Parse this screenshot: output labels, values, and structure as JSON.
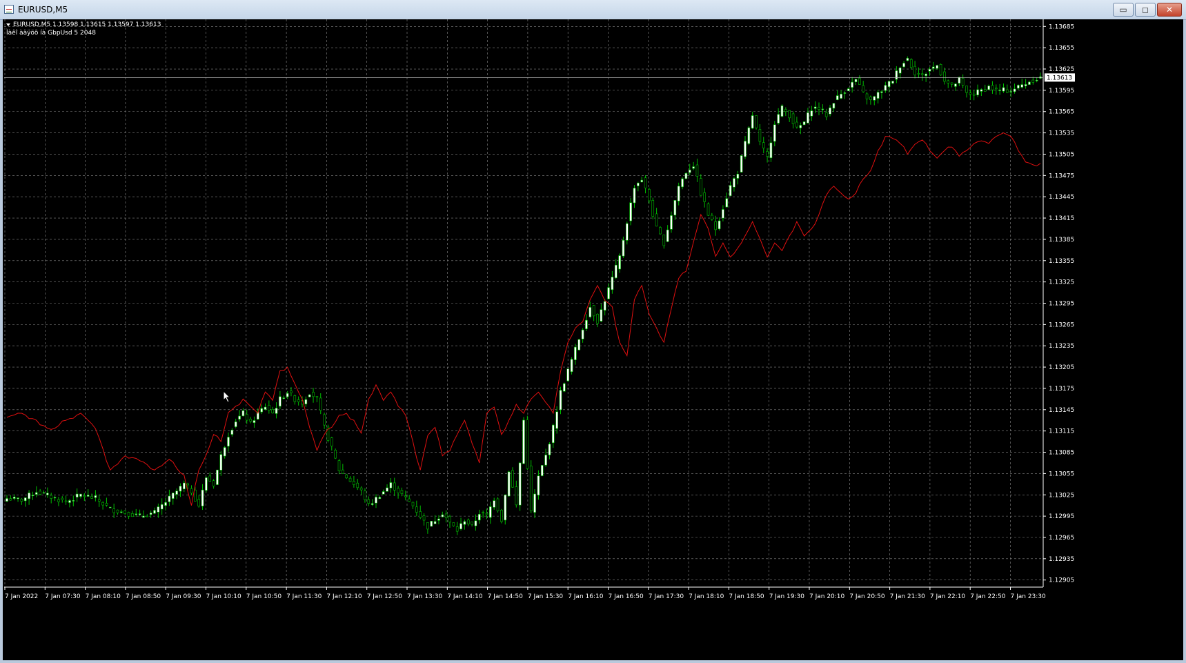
{
  "window": {
    "title": "EURUSD,M5",
    "minimize": "▭",
    "maximize": "◻",
    "close": "✕"
  },
  "header": {
    "symbol_line": "EURUSD,M5  1.13598 1.13615 1.13597 1.13613",
    "indicator_line": "Ìàêî àäÿöõ íà GbpUsd 5 2048"
  },
  "colors": {
    "background": "#000000",
    "grid": "#8a8a8a",
    "axis": "#ffffff",
    "bull_candle": "#ffffff",
    "bear_candle": "#000000",
    "wick": "#00c000",
    "overlay_line": "#e01010",
    "price_line": "#b0b0b0"
  },
  "chart_data": {
    "type": "candlestick",
    "symbol": "EURUSD",
    "timeframe": "M5",
    "current_price": 1.13613,
    "current_price_label": "1.13613",
    "y_ticks": [
      "1.13685",
      "1.13655",
      "1.13625",
      "1.13595",
      "1.13565",
      "1.13535",
      "1.13505",
      "1.13475",
      "1.13445",
      "1.13415",
      "1.13385",
      "1.13355",
      "1.13325",
      "1.13295",
      "1.13265",
      "1.13235",
      "1.13205",
      "1.13175",
      "1.13145",
      "1.13115",
      "1.13085",
      "1.13055",
      "1.13025",
      "1.12995",
      "1.12965",
      "1.12935",
      "1.12905"
    ],
    "x_ticks": [
      "7 Jan 2022",
      "7 Jan 07:30",
      "7 Jan 08:10",
      "7 Jan 08:50",
      "7 Jan 09:30",
      "7 Jan 10:10",
      "7 Jan 10:50",
      "7 Jan 11:30",
      "7 Jan 12:10",
      "7 Jan 12:50",
      "7 Jan 13:30",
      "7 Jan 14:10",
      "7 Jan 14:50",
      "7 Jan 15:30",
      "7 Jan 16:10",
      "7 Jan 16:50",
      "7 Jan 17:30",
      "7 Jan 18:10",
      "7 Jan 18:50",
      "7 Jan 19:30",
      "7 Jan 20:10",
      "7 Jan 20:50",
      "7 Jan 21:30",
      "7 Jan 22:10",
      "7 Jan 22:50",
      "7 Jan 23:30"
    ],
    "ylim": [
      1.12895,
      1.13695
    ],
    "close_path": [
      [
        0,
        1.1302
      ],
      [
        4,
        1.13018
      ],
      [
        8,
        1.1303
      ],
      [
        12,
        1.13022
      ],
      [
        16,
        1.13015
      ],
      [
        20,
        1.13025
      ],
      [
        24,
        1.1302
      ],
      [
        28,
        1.13005
      ],
      [
        32,
        1.13
      ],
      [
        36,
        1.12995
      ],
      [
        40,
        1.13
      ],
      [
        44,
        1.1302
      ],
      [
        48,
        1.1304
      ],
      [
        50,
        1.1303
      ],
      [
        52,
        1.1301
      ],
      [
        54,
        1.1305
      ],
      [
        56,
        1.1304
      ],
      [
        58,
        1.1308
      ],
      [
        60,
        1.1311
      ],
      [
        62,
        1.1313
      ],
      [
        64,
        1.1314
      ],
      [
        66,
        1.13125
      ],
      [
        68,
        1.1314
      ],
      [
        70,
        1.1315
      ],
      [
        72,
        1.1314
      ],
      [
        74,
        1.1316
      ],
      [
        76,
        1.1317
      ],
      [
        78,
        1.1316
      ],
      [
        80,
        1.13155
      ],
      [
        82,
        1.1317
      ],
      [
        84,
        1.1316
      ],
      [
        86,
        1.1312
      ],
      [
        88,
        1.1309
      ],
      [
        90,
        1.1306
      ],
      [
        92,
        1.1305
      ],
      [
        94,
        1.1304
      ],
      [
        96,
        1.1303
      ],
      [
        98,
        1.1301
      ],
      [
        100,
        1.1302
      ],
      [
        102,
        1.1303
      ],
      [
        104,
        1.1304
      ],
      [
        106,
        1.1303
      ],
      [
        108,
        1.1302
      ],
      [
        110,
        1.1301
      ],
      [
        112,
        1.12995
      ],
      [
        114,
        1.1298
      ],
      [
        116,
        1.1299
      ],
      [
        118,
        1.13
      ],
      [
        120,
        1.12985
      ],
      [
        122,
        1.12975
      ],
      [
        124,
        1.1299
      ],
      [
        126,
        1.1298
      ],
      [
        128,
        1.13
      ],
      [
        130,
        1.12995
      ],
      [
        132,
        1.1302
      ],
      [
        134,
        1.1299
      ],
      [
        136,
        1.1306
      ],
      [
        138,
        1.1301
      ],
      [
        140,
        1.1313
      ],
      [
        142,
        1.13
      ],
      [
        144,
        1.1305
      ],
      [
        146,
        1.1308
      ],
      [
        148,
        1.1312
      ],
      [
        150,
        1.1317
      ],
      [
        152,
        1.132
      ],
      [
        154,
        1.1323
      ],
      [
        156,
        1.1326
      ],
      [
        158,
        1.1329
      ],
      [
        160,
        1.1327
      ],
      [
        162,
        1.133
      ],
      [
        164,
        1.1333
      ],
      [
        166,
        1.1336
      ],
      [
        168,
        1.1341
      ],
      [
        170,
        1.1346
      ],
      [
        172,
        1.1347
      ],
      [
        174,
        1.1344
      ],
      [
        176,
        1.134
      ],
      [
        178,
        1.1338
      ],
      [
        180,
        1.1342
      ],
      [
        182,
        1.1346
      ],
      [
        184,
        1.1348
      ],
      [
        186,
        1.1349
      ],
      [
        188,
        1.1345
      ],
      [
        190,
        1.1342
      ],
      [
        192,
        1.134
      ],
      [
        194,
        1.1343
      ],
      [
        196,
        1.1346
      ],
      [
        198,
        1.1348
      ],
      [
        200,
        1.1352
      ],
      [
        202,
        1.1356
      ],
      [
        204,
        1.1352
      ],
      [
        206,
        1.135
      ],
      [
        208,
        1.1355
      ],
      [
        210,
        1.1357
      ],
      [
        212,
        1.1356
      ],
      [
        214,
        1.1354
      ],
      [
        216,
        1.1355
      ],
      [
        218,
        1.1357
      ],
      [
        220,
        1.1357
      ],
      [
        222,
        1.1356
      ],
      [
        224,
        1.1358
      ],
      [
        226,
        1.1359
      ],
      [
        228,
        1.136
      ],
      [
        230,
        1.1361
      ],
      [
        232,
        1.1359
      ],
      [
        234,
        1.1358
      ],
      [
        236,
        1.1359
      ],
      [
        238,
        1.136
      ],
      [
        240,
        1.1361
      ],
      [
        242,
        1.1363
      ],
      [
        244,
        1.1364
      ],
      [
        246,
        1.1362
      ],
      [
        248,
        1.13615
      ],
      [
        250,
        1.13625
      ],
      [
        252,
        1.1363
      ],
      [
        254,
        1.1361
      ],
      [
        256,
        1.136
      ],
      [
        258,
        1.1361
      ],
      [
        260,
        1.1359
      ],
      [
        262,
        1.1359
      ],
      [
        264,
        1.13595
      ],
      [
        266,
        1.136
      ],
      [
        268,
        1.13595
      ],
      [
        270,
        1.13595
      ],
      [
        272,
        1.13595
      ],
      [
        274,
        1.136
      ],
      [
        276,
        1.13605
      ],
      [
        278,
        1.1361
      ],
      [
        280,
        1.13613
      ]
    ],
    "overlay_path": [
      [
        0,
        1.13135
      ],
      [
        4,
        1.1314
      ],
      [
        8,
        1.1313
      ],
      [
        12,
        1.13115
      ],
      [
        16,
        1.1313
      ],
      [
        20,
        1.1314
      ],
      [
        24,
        1.1312
      ],
      [
        28,
        1.1306
      ],
      [
        32,
        1.1308
      ],
      [
        36,
        1.13075
      ],
      [
        40,
        1.1306
      ],
      [
        44,
        1.13075
      ],
      [
        48,
        1.1305
      ],
      [
        50,
        1.1301
      ],
      [
        52,
        1.1306
      ],
      [
        54,
        1.1308
      ],
      [
        56,
        1.1311
      ],
      [
        58,
        1.131
      ],
      [
        60,
        1.1314
      ],
      [
        62,
        1.1315
      ],
      [
        64,
        1.1316
      ],
      [
        66,
        1.1315
      ],
      [
        68,
        1.1314
      ],
      [
        70,
        1.1317
      ],
      [
        72,
        1.1316
      ],
      [
        74,
        1.132
      ],
      [
        76,
        1.13205
      ],
      [
        78,
        1.1318
      ],
      [
        80,
        1.1316
      ],
      [
        82,
        1.1312
      ],
      [
        84,
        1.1309
      ],
      [
        86,
        1.1311
      ],
      [
        88,
        1.1312
      ],
      [
        90,
        1.13135
      ],
      [
        92,
        1.1314
      ],
      [
        94,
        1.1313
      ],
      [
        96,
        1.1311
      ],
      [
        98,
        1.1316
      ],
      [
        100,
        1.1318
      ],
      [
        102,
        1.1316
      ],
      [
        104,
        1.1317
      ],
      [
        106,
        1.1315
      ],
      [
        108,
        1.1314
      ],
      [
        110,
        1.131
      ],
      [
        112,
        1.1306
      ],
      [
        114,
        1.1311
      ],
      [
        116,
        1.1312
      ],
      [
        118,
        1.1308
      ],
      [
        120,
        1.1309
      ],
      [
        122,
        1.1311
      ],
      [
        124,
        1.1313
      ],
      [
        126,
        1.131
      ],
      [
        128,
        1.1307
      ],
      [
        130,
        1.1314
      ],
      [
        132,
        1.1315
      ],
      [
        134,
        1.1311
      ],
      [
        136,
        1.1313
      ],
      [
        138,
        1.1315
      ],
      [
        140,
        1.1314
      ],
      [
        142,
        1.1316
      ],
      [
        144,
        1.1317
      ],
      [
        146,
        1.13155
      ],
      [
        148,
        1.1314
      ],
      [
        150,
        1.132
      ],
      [
        152,
        1.1324
      ],
      [
        154,
        1.1326
      ],
      [
        156,
        1.1327
      ],
      [
        158,
        1.133
      ],
      [
        160,
        1.1332
      ],
      [
        162,
        1.133
      ],
      [
        164,
        1.1329
      ],
      [
        166,
        1.1324
      ],
      [
        168,
        1.1322
      ],
      [
        170,
        1.133
      ],
      [
        172,
        1.1332
      ],
      [
        174,
        1.1328
      ],
      [
        176,
        1.1326
      ],
      [
        178,
        1.1324
      ],
      [
        180,
        1.1329
      ],
      [
        182,
        1.1333
      ],
      [
        184,
        1.1334
      ],
      [
        186,
        1.1338
      ],
      [
        188,
        1.1342
      ],
      [
        190,
        1.134
      ],
      [
        192,
        1.1336
      ],
      [
        194,
        1.1338
      ],
      [
        196,
        1.1336
      ],
      [
        198,
        1.1337
      ],
      [
        200,
        1.1339
      ],
      [
        202,
        1.1341
      ],
      [
        204,
        1.13385
      ],
      [
        206,
        1.1336
      ],
      [
        208,
        1.1338
      ],
      [
        210,
        1.1337
      ],
      [
        212,
        1.1339
      ],
      [
        214,
        1.1341
      ],
      [
        216,
        1.1339
      ],
      [
        218,
        1.134
      ],
      [
        220,
        1.1342
      ],
      [
        222,
        1.1345
      ],
      [
        224,
        1.1346
      ],
      [
        226,
        1.1345
      ],
      [
        228,
        1.1344
      ],
      [
        230,
        1.1345
      ],
      [
        232,
        1.1347
      ],
      [
        234,
        1.1348
      ],
      [
        236,
        1.1351
      ],
      [
        238,
        1.1353
      ],
      [
        240,
        1.1353
      ],
      [
        242,
        1.1352
      ],
      [
        244,
        1.13505
      ],
      [
        246,
        1.1352
      ],
      [
        248,
        1.13525
      ],
      [
        250,
        1.1351
      ],
      [
        252,
        1.135
      ],
      [
        254,
        1.1351
      ],
      [
        256,
        1.13515
      ],
      [
        258,
        1.13505
      ],
      [
        260,
        1.1351
      ],
      [
        262,
        1.1352
      ],
      [
        264,
        1.13525
      ],
      [
        266,
        1.1352
      ],
      [
        268,
        1.1353
      ],
      [
        270,
        1.13535
      ],
      [
        272,
        1.1353
      ],
      [
        274,
        1.1351
      ],
      [
        276,
        1.13495
      ],
      [
        278,
        1.1349
      ],
      [
        280,
        1.13492
      ]
    ]
  }
}
